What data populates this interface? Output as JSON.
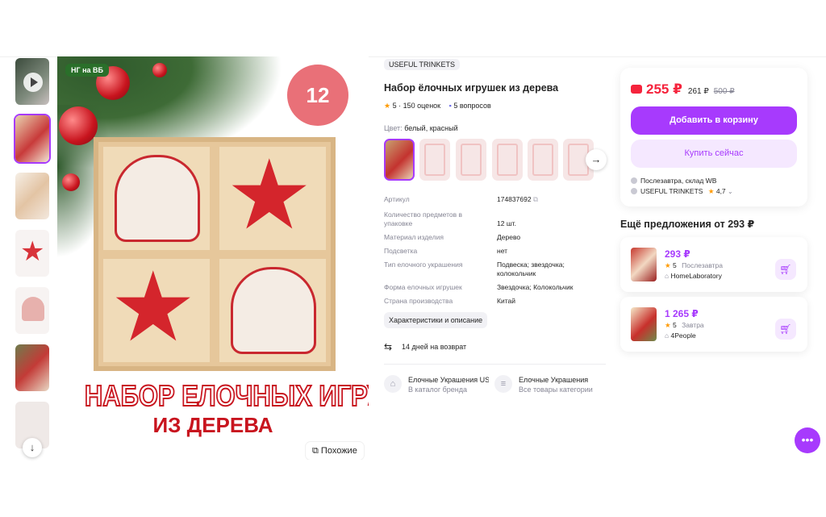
{
  "gallery": {
    "ng_badge": "НГ на ВБ",
    "count_badge": "12 ШТ",
    "headline": "НАБОР ЕЛОЧНЫХ ИГРУШЕК",
    "subhead": "ИЗ ДЕРЕВА",
    "similar_label": "Похожие"
  },
  "product": {
    "brand": "USEFUL TRINKETS",
    "title": "Набор ёлочных игрушек из дерева",
    "rating": "5",
    "reviews": "150 оценок",
    "questions": "5 вопросов",
    "color_label": "Цвет:",
    "color_value": "белый, красный",
    "specs": [
      {
        "key": "Артикул",
        "value": "174837692"
      },
      {
        "key": "Количество предметов в упаковке",
        "value": "12 шт."
      },
      {
        "key": "Материал изделия",
        "value": "Дерево"
      },
      {
        "key": "Подсветка",
        "value": "нет"
      },
      {
        "key": "Тип елочного украшения",
        "value": "Подвеска; звездочка; колокольчик"
      },
      {
        "key": "Форма елочных игрушек",
        "value": "Звездочка; Колокольчик"
      },
      {
        "key": "Страна производства",
        "value": "Китай"
      }
    ],
    "chars_button": "Характеристики и описание",
    "return_text": "14 дней на возврат",
    "brand_link": {
      "title": "Елочные Украшения US",
      "sub": "В каталог бренда"
    },
    "category_link": {
      "title": "Елочные Украшения",
      "sub": "Все товары категории"
    }
  },
  "buy": {
    "price": "255 ₽",
    "price_wb": "261 ₽",
    "price_old": "500 ₽",
    "add_to_cart": "Добавить в корзину",
    "buy_now": "Купить сейчас",
    "delivery": "Послезавтра, склад WB",
    "seller": "USEFUL TRINKETS",
    "seller_rating": "4,7"
  },
  "offers": {
    "title": "Ещё предложения от 293 ₽",
    "items": [
      {
        "price": "293 ₽",
        "rating": "5",
        "when": "Послезавтра",
        "shop": "HomeLaboratory"
      },
      {
        "price": "1 265 ₽",
        "rating": "5",
        "when": "Завтра",
        "shop": "4People"
      }
    ]
  },
  "colors": {
    "accent": "#a73afd",
    "price_red": "#f5233c",
    "star": "#ff9a00"
  }
}
